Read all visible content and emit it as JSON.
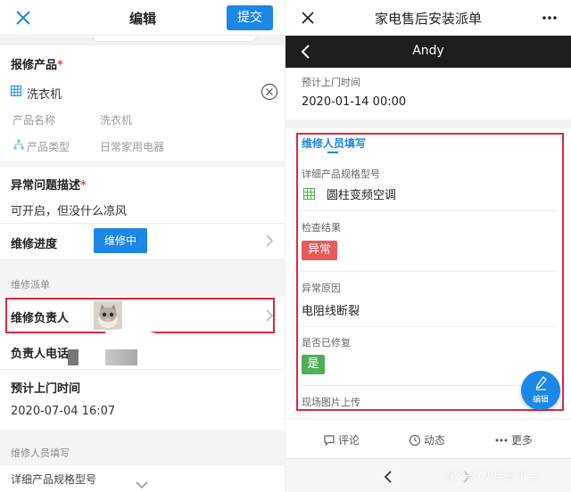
{
  "left": {
    "header": {
      "title": "编辑",
      "submit_label": "提交"
    },
    "product": {
      "label": "报修产品",
      "required_mark": "*",
      "selected": "洗衣机",
      "name_label": "产品名称",
      "name_value": "洗衣机",
      "type_label": "产品类型",
      "type_value": "日常家用电器"
    },
    "issue": {
      "label": "异常问题描述",
      "required_mark": "*",
      "value": "可开启，但没什么凉风"
    },
    "progress": {
      "label": "维修进度",
      "status": "维修中"
    },
    "dispatch": {
      "section_title": "维修派单",
      "assignee_label": "维修负责人",
      "phone_label": "负责人电话",
      "visit_label": "预计上门时间",
      "visit_value": "2020-07-04 16:07"
    },
    "repair_section": {
      "title": "维修人员填写",
      "model_label": "详细产品规格型号"
    }
  },
  "right": {
    "header": {
      "title": "家电售后安装派单"
    },
    "nav": {
      "title": "Andy"
    },
    "visit": {
      "label": "预计上门时间",
      "value": "2020-01-14 00:00"
    },
    "section": {
      "title": "维修人员填写",
      "model_label": "详细产品规格型号",
      "model_value": "圆柱变频空调",
      "check_label": "检查结果",
      "check_value": "异常",
      "cause_label": "异常原因",
      "cause_value": "电阻线断裂",
      "repaired_label": "是否已修复",
      "repaired_value": "是",
      "photo_label": "现场图片上传"
    },
    "fab_label": "编辑",
    "actions": {
      "comment": "评论",
      "activity": "动态",
      "more": "更多"
    },
    "watermark": "百家号/伙伴云平台"
  },
  "colors": {
    "accent": "#1c87e5",
    "highlight_border": "#e0283a",
    "tag_abnormal": "#e65a5a",
    "tag_yes": "#4fae5b",
    "nav_dark": "#1e1e1e"
  }
}
